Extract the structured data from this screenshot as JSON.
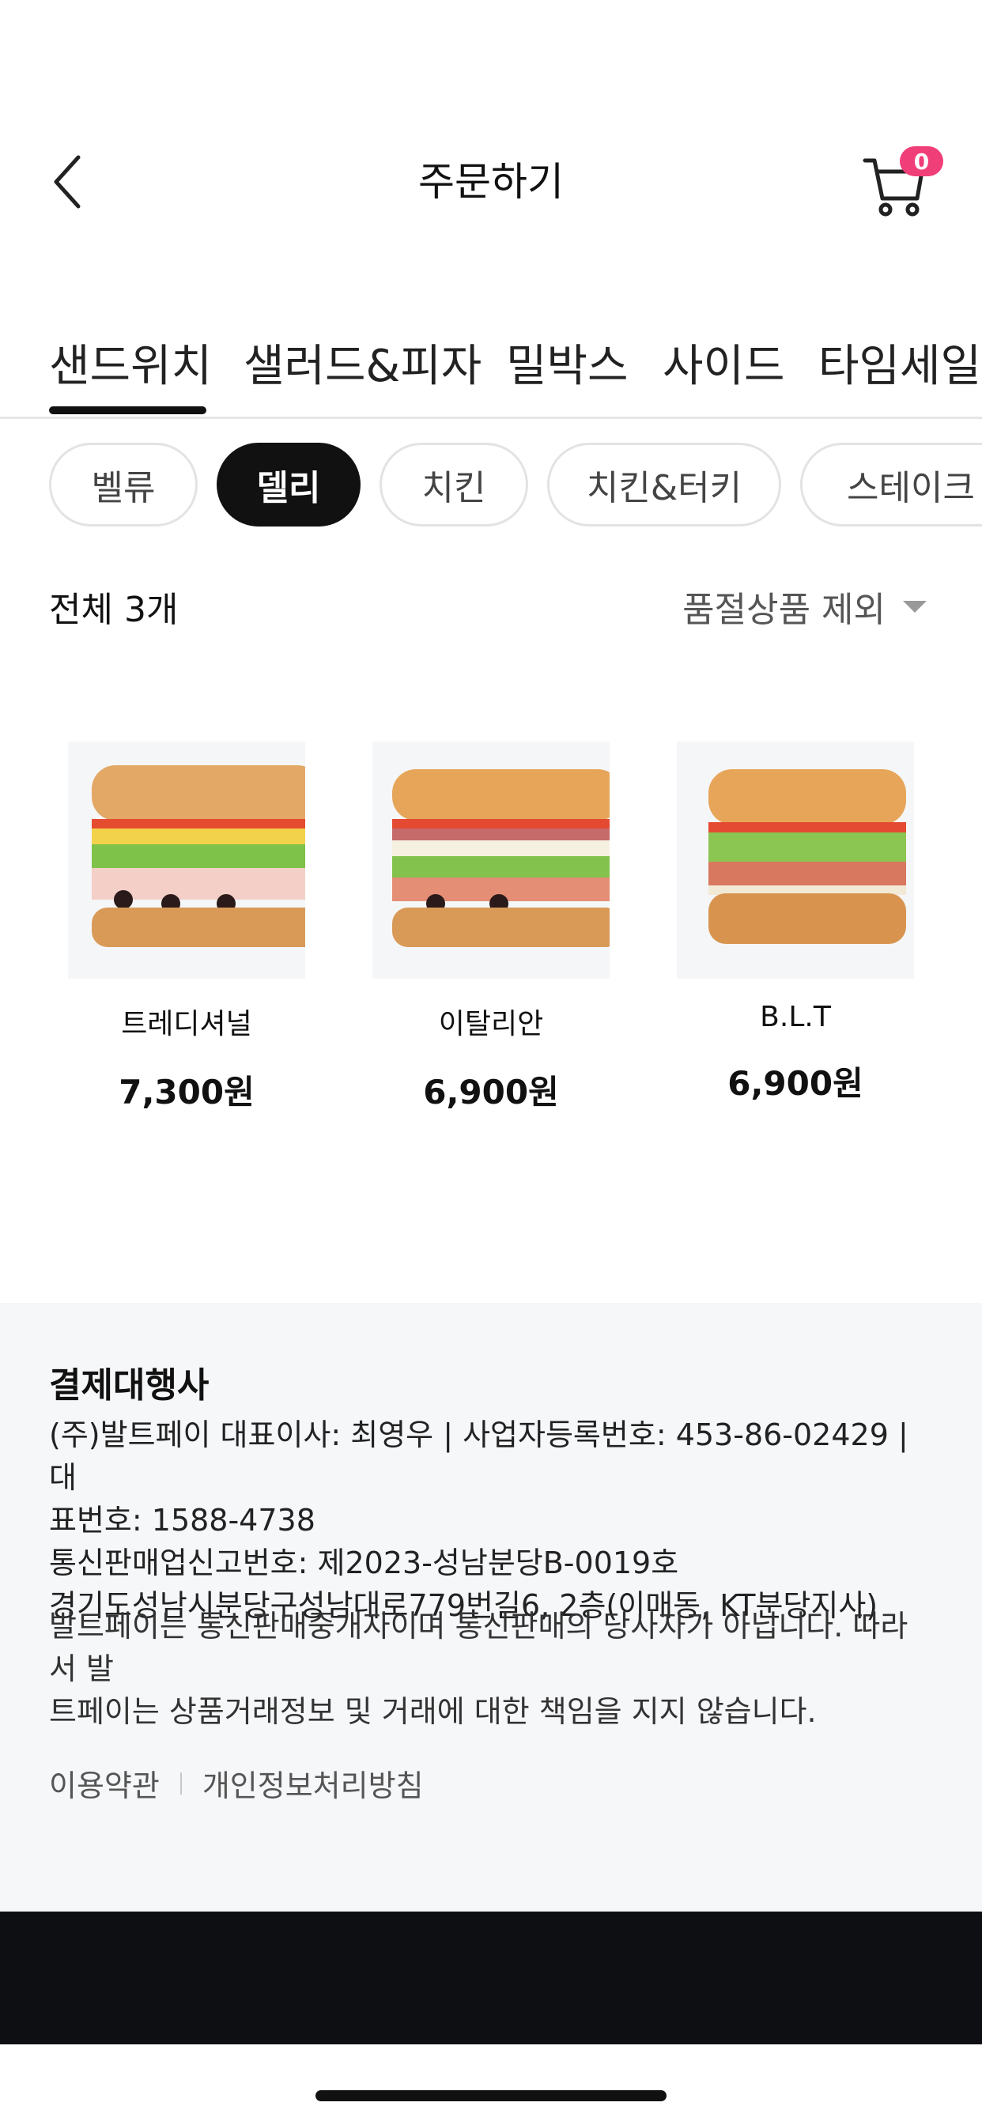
{
  "header": {
    "title": "주문하기",
    "cart_count": "0",
    "back_icon": "chevron-left-icon",
    "cart_icon": "cart-icon",
    "badge_color": "#f03e78"
  },
  "categories": [
    {
      "label": "샌드위치",
      "active": true
    },
    {
      "label": "샐러드&피자",
      "active": false
    },
    {
      "label": "밀박스",
      "active": false
    },
    {
      "label": "사이드",
      "active": false
    },
    {
      "label": "타임세일(",
      "active": false
    }
  ],
  "chips": [
    {
      "label": "벨류",
      "active": false
    },
    {
      "label": "델리",
      "active": true
    },
    {
      "label": "치킨",
      "active": false
    },
    {
      "label": "치킨&터키",
      "active": false
    },
    {
      "label": "스테이크",
      "active": false
    }
  ],
  "list": {
    "total": "전체 3개",
    "sort_label": "품절상품 제외"
  },
  "products": [
    {
      "name": "트레디셔널",
      "price": "7,300원"
    },
    {
      "name": "이탈리안",
      "price": "6,900원"
    },
    {
      "name": "B.L.T",
      "price": "6,900원"
    }
  ],
  "footer": {
    "title": "결제대행사",
    "line1": "(주)발트페이 대표이사: 최영우 | 사업자등록번호: 453-86-02429 | 대",
    "line2": "표번호: 1588-4738",
    "line3": "통신판매업신고번호: 제2023-성남분당B-0019호",
    "line4": "경기도성남시분당구성남대로779번길6, 2층(이매동, KT분당지사)",
    "note1": "발트페이는 통신판매중개자이며 통신판매의 당사자가 아닙니다. 따라서 발",
    "note2": "트페이는 상품거래정보 및 거래에 대한 책임을 지지 않습니다.",
    "link_terms": "이용약관",
    "link_privacy": "개인정보처리방침"
  }
}
